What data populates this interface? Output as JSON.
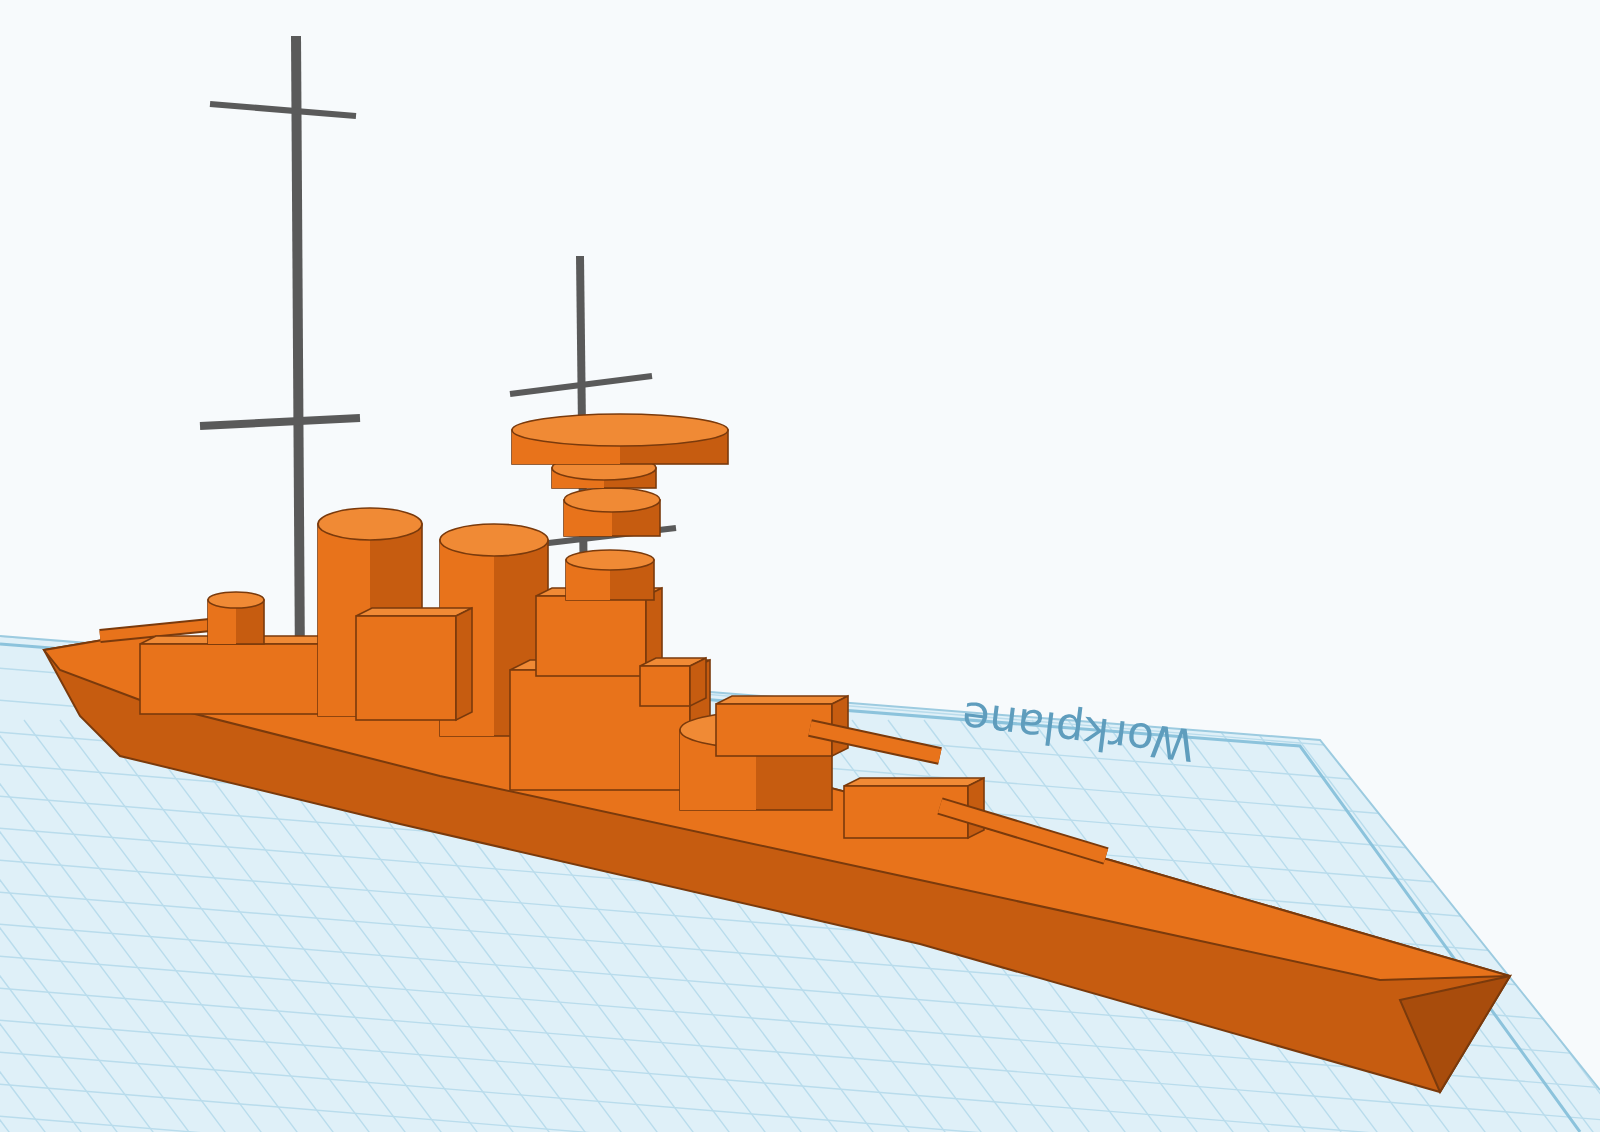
{
  "workplane": {
    "label": "Workplane"
  }
}
